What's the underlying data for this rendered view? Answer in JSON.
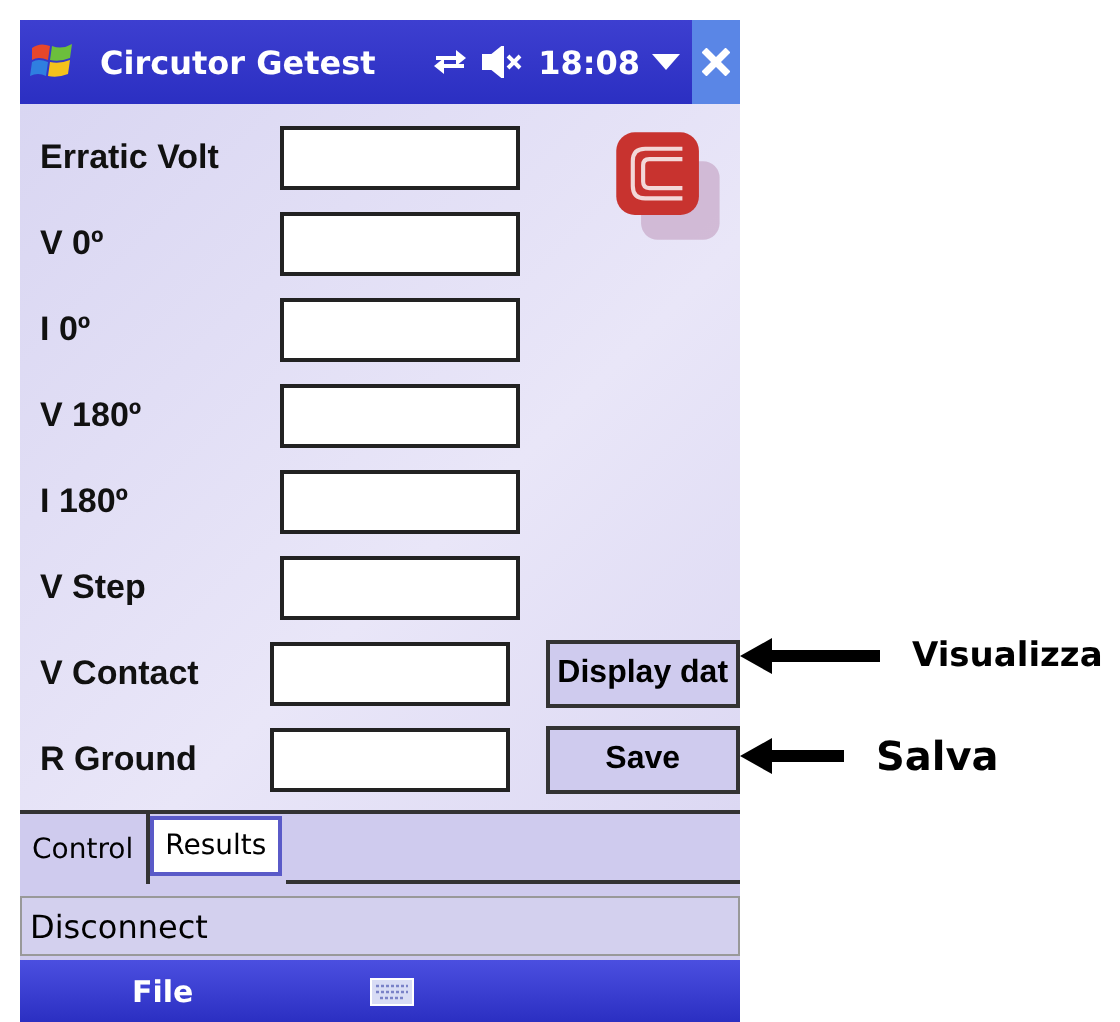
{
  "title_bar": {
    "title": "Circutor Getest",
    "time": "18:08"
  },
  "fields": [
    {
      "label": "Erratic Volt"
    },
    {
      "label": "V 0º"
    },
    {
      "label": "I 0º"
    },
    {
      "label": "V 180º"
    },
    {
      "label": "I 180º"
    },
    {
      "label": "V Step"
    },
    {
      "label": "V Contact"
    },
    {
      "label": "R Ground"
    }
  ],
  "buttons": [
    {
      "label": "Display dat"
    },
    {
      "label": "Save"
    }
  ],
  "tabs": [
    {
      "label": "Control",
      "selected": false
    },
    {
      "label": "Results",
      "selected": true
    }
  ],
  "disconnect_button": "Disconnect",
  "menu_bar": {
    "left": "File"
  },
  "annotations": [
    {
      "text": "Visualizza"
    },
    {
      "text": "Salva"
    }
  ]
}
